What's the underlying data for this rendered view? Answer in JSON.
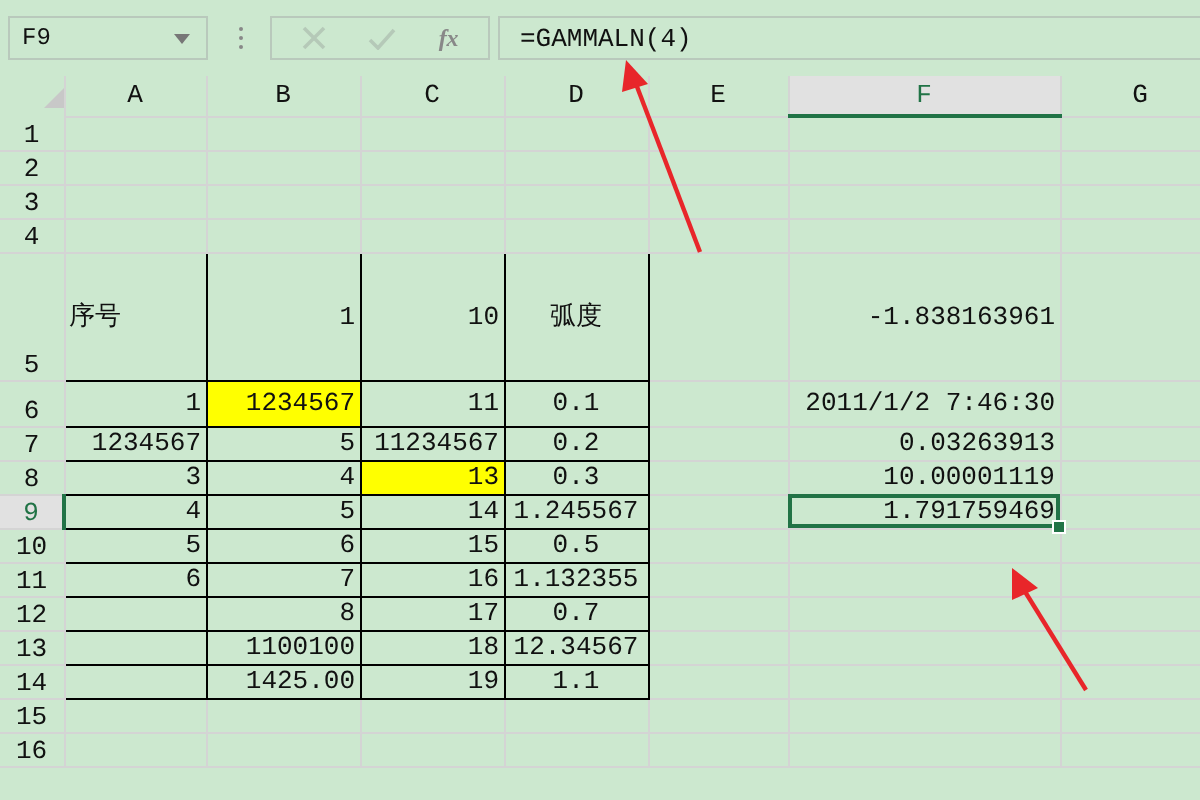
{
  "name_box": "F9",
  "formula_bar": {
    "fx": "fx",
    "formula": "=GAMMALN(4)"
  },
  "columns": [
    {
      "label": "A",
      "selected": false
    },
    {
      "label": "B",
      "selected": false
    },
    {
      "label": "C",
      "selected": false
    },
    {
      "label": "D",
      "selected": false
    },
    {
      "label": "E",
      "selected": false
    },
    {
      "label": "F",
      "selected": true
    },
    {
      "label": "G",
      "selected": false
    }
  ],
  "rows": [
    {
      "number": "1",
      "kind": "normal",
      "selected": false,
      "bordered": false,
      "cells": [
        null,
        null,
        null,
        null,
        null,
        null,
        null
      ]
    },
    {
      "number": "2",
      "kind": "normal",
      "selected": false,
      "bordered": false,
      "cells": [
        null,
        null,
        null,
        null,
        null,
        null,
        null
      ]
    },
    {
      "number": "3",
      "kind": "normal",
      "selected": false,
      "bordered": false,
      "cells": [
        null,
        null,
        null,
        null,
        null,
        null,
        null
      ]
    },
    {
      "number": "4",
      "kind": "normal",
      "selected": false,
      "bordered": false,
      "cells": [
        null,
        null,
        null,
        null,
        null,
        null,
        null
      ]
    },
    {
      "number": "5",
      "kind": "tall",
      "selected": false,
      "bordered": true,
      "cells": [
        {
          "text": "序号",
          "highlighted": false
        },
        {
          "text": "1",
          "highlighted": false
        },
        {
          "text": "10",
          "highlighted": false
        },
        {
          "text": "弧度",
          "highlighted": false
        },
        null,
        {
          "text": "-1.838163961",
          "highlighted": false
        },
        null
      ]
    },
    {
      "number": "6",
      "kind": "medium",
      "selected": false,
      "bordered": true,
      "cells": [
        {
          "text": "1",
          "highlighted": false
        },
        {
          "text": "1234567",
          "highlighted": true
        },
        {
          "text": "11",
          "highlighted": false
        },
        {
          "text": "0.1",
          "highlighted": false
        },
        null,
        {
          "text": "2011/1/2 7:46:30",
          "highlighted": false
        },
        null
      ]
    },
    {
      "number": "7",
      "kind": "normal",
      "selected": false,
      "bordered": true,
      "cells": [
        {
          "text": "1234567",
          "highlighted": false
        },
        {
          "text": "5",
          "highlighted": false
        },
        {
          "text": "11234567",
          "highlighted": false
        },
        {
          "text": "0.2",
          "highlighted": false
        },
        null,
        {
          "text": "0.03263913",
          "highlighted": false
        },
        null
      ]
    },
    {
      "number": "8",
      "kind": "normal",
      "selected": false,
      "bordered": true,
      "cells": [
        {
          "text": "3",
          "highlighted": false
        },
        {
          "text": "4",
          "highlighted": false
        },
        {
          "text": "13",
          "highlighted": true
        },
        {
          "text": "0.3",
          "highlighted": false
        },
        null,
        {
          "text": "10.00001119",
          "highlighted": false
        },
        null
      ]
    },
    {
      "number": "9",
      "kind": "normal",
      "selected": true,
      "bordered": true,
      "cells": [
        {
          "text": "4",
          "highlighted": false
        },
        {
          "text": "5",
          "highlighted": false
        },
        {
          "text": "14",
          "highlighted": false
        },
        {
          "text": "1.245567",
          "highlighted": false
        },
        null,
        {
          "text": "1.791759469",
          "highlighted": false
        },
        null
      ]
    },
    {
      "number": "10",
      "kind": "normal",
      "selected": false,
      "bordered": true,
      "cells": [
        {
          "text": "5",
          "highlighted": false
        },
        {
          "text": "6",
          "highlighted": false
        },
        {
          "text": "15",
          "highlighted": false
        },
        {
          "text": "0.5",
          "highlighted": false
        },
        null,
        null,
        null
      ]
    },
    {
      "number": "11",
      "kind": "normal",
      "selected": false,
      "bordered": true,
      "cells": [
        {
          "text": "6",
          "highlighted": false
        },
        {
          "text": "7",
          "highlighted": false
        },
        {
          "text": "16",
          "highlighted": false
        },
        {
          "text": "1.132355",
          "highlighted": false
        },
        null,
        null,
        null
      ]
    },
    {
      "number": "12",
      "kind": "normal",
      "selected": false,
      "bordered": true,
      "cells": [
        null,
        {
          "text": "8",
          "highlighted": false
        },
        {
          "text": "17",
          "highlighted": false
        },
        {
          "text": "0.7",
          "highlighted": false
        },
        null,
        null,
        null
      ]
    },
    {
      "number": "13",
      "kind": "normal",
      "selected": false,
      "bordered": true,
      "cells": [
        null,
        {
          "text": "1100100",
          "highlighted": false
        },
        {
          "text": "18",
          "highlighted": false
        },
        {
          "text": "12.34567",
          "highlighted": false
        },
        null,
        null,
        null
      ]
    },
    {
      "number": "14",
      "kind": "normal",
      "selected": false,
      "bordered": true,
      "cells": [
        null,
        {
          "text": "1425.00",
          "highlighted": false
        },
        {
          "text": "19",
          "highlighted": false
        },
        {
          "text": "1.1",
          "highlighted": false
        },
        null,
        null,
        null
      ]
    },
    {
      "number": "15",
      "kind": "normal",
      "selected": false,
      "bordered": false,
      "cells": [
        null,
        null,
        null,
        null,
        null,
        null,
        null
      ]
    },
    {
      "number": "16",
      "kind": "normal",
      "selected": false,
      "bordered": false,
      "cells": [
        null,
        null,
        null,
        null,
        null,
        null,
        null
      ]
    }
  ]
}
